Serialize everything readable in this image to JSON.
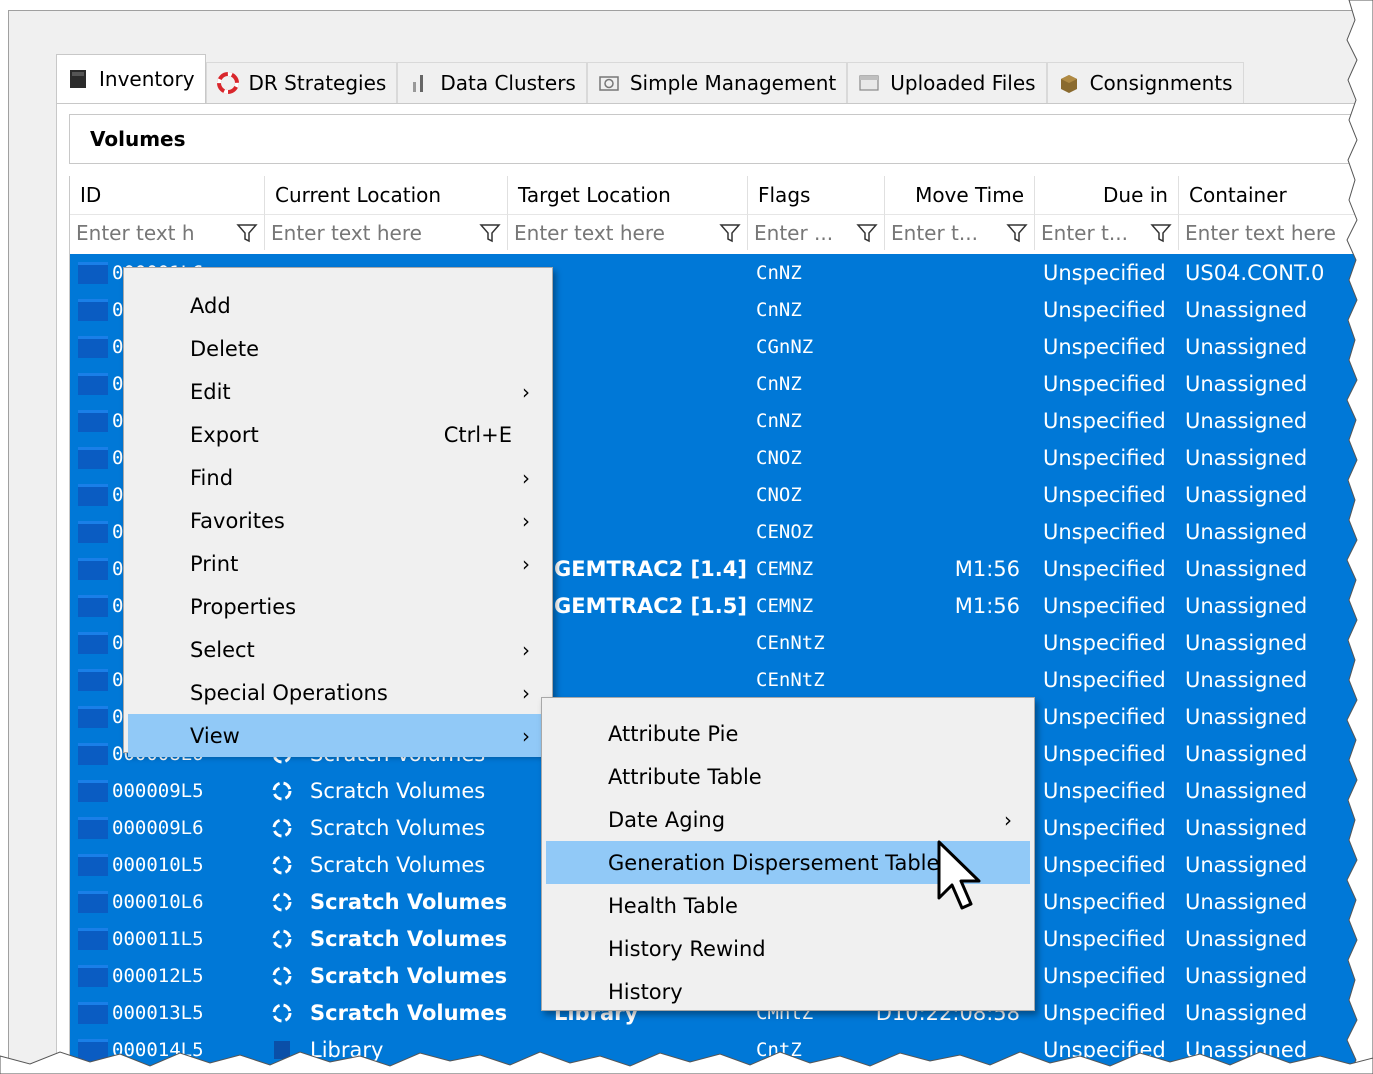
{
  "tabs": [
    {
      "label": "Inventory",
      "icon": "cartridge-icon",
      "active": true
    },
    {
      "label": "DR Strategies",
      "icon": "lifebuoy-icon",
      "active": false
    },
    {
      "label": "Data Clusters",
      "icon": "cluster-icon",
      "active": false
    },
    {
      "label": "Simple Management",
      "icon": "camera-icon",
      "active": false
    },
    {
      "label": "Uploaded Files",
      "icon": "folder-icon",
      "active": false
    },
    {
      "label": "Consignments",
      "icon": "box-icon",
      "active": false
    }
  ],
  "section_title": "Volumes",
  "columns": [
    "ID",
    "Current Location",
    "Target Location",
    "Flags",
    "Move Time",
    "Due in",
    "Container"
  ],
  "filter_placeholders": [
    "Enter text h",
    "Enter text here",
    "Enter text here",
    "Enter ...",
    "Enter t...",
    "Enter t...",
    "Enter text here"
  ],
  "rows": [
    {
      "id": "000001L6",
      "flags": "CnNZ",
      "due": "Unspecified",
      "container": "US04.CONT.0"
    },
    {
      "id": "0",
      "flags": "CnNZ",
      "due": "Unspecified",
      "container": "Unassigned"
    },
    {
      "id": "0",
      "flags": "CGnNZ",
      "due": "Unspecified",
      "container": "Unassigned"
    },
    {
      "id": "0",
      "flags": "CnNZ",
      "due": "Unspecified",
      "container": "Unassigned"
    },
    {
      "id": "0",
      "flags": "CnNZ",
      "due": "Unspecified",
      "container": "Unassigned"
    },
    {
      "id": "0",
      "flags": "CNOZ",
      "due": "Unspecified",
      "container": "Unassigned"
    },
    {
      "id": "0",
      "flags": "CNOZ",
      "due": "Unspecified",
      "container": "Unassigned"
    },
    {
      "id": "0",
      "flags": "CENOZ",
      "due": "Unspecified",
      "container": "Unassigned"
    },
    {
      "id": "0",
      "target": "GEMTRAC2 [1.4]",
      "flags": "CEMNZ",
      "move": "M1:56",
      "due": "Unspecified",
      "container": "Unassigned"
    },
    {
      "id": "0",
      "target": "GEMTRAC2 [1.5]",
      "flags": "CEMNZ",
      "move": "M1:56",
      "due": "Unspecified",
      "container": "Unassigned"
    },
    {
      "id": "0",
      "flags": "CEnNtZ",
      "due": "Unspecified",
      "container": "Unassigned"
    },
    {
      "id": "0",
      "flags": "CEnNtZ",
      "due": "Unspecified",
      "container": "Unassigned"
    },
    {
      "id": "0",
      "due": "Unspecified",
      "container": "Unassigned"
    },
    {
      "id": "000008L6",
      "location": "Scratch Volumes",
      "due": "Unspecified",
      "container": "Unassigned"
    },
    {
      "id": "000009L5",
      "location": "Scratch Volumes",
      "due": "Unspecified",
      "container": "Unassigned"
    },
    {
      "id": "000009L6",
      "location": "Scratch Volumes",
      "due": "Unspecified",
      "container": "Unassigned"
    },
    {
      "id": "000010L5",
      "location": "Scratch Volumes",
      "due": "Unspecified",
      "container": "Unassigned"
    },
    {
      "id": "000010L6",
      "location": "Scratch Volumes",
      "bold": true,
      "due": "Unspecified",
      "container": "Unassigned"
    },
    {
      "id": "000011L5",
      "location": "Scratch Volumes",
      "bold": true,
      "due": "Unspecified",
      "container": "Unassigned"
    },
    {
      "id": "000012L5",
      "location": "Scratch Volumes",
      "bold": true,
      "due": "Unspecified",
      "container": "Unassigned"
    },
    {
      "id": "000013L5",
      "location": "Scratch Volumes",
      "bold": true,
      "target": "Library",
      "flags": "CMntZ",
      "move": "D10:22:08:58",
      "due": "Unspecified",
      "container": "Unassigned"
    },
    {
      "id": "000014L5",
      "location": "Library",
      "flags": "CntZ",
      "due": "Unspecified",
      "container": "Unassigned"
    }
  ],
  "context_menu": [
    {
      "label": "Add"
    },
    {
      "label": "Delete"
    },
    {
      "label": "Edit",
      "submenu": true
    },
    {
      "label": "Export",
      "shortcut": "Ctrl+E"
    },
    {
      "label": "Find",
      "submenu": true
    },
    {
      "label": "Favorites",
      "submenu": true
    },
    {
      "label": "Print",
      "submenu": true
    },
    {
      "label": "Properties"
    },
    {
      "label": "Select",
      "submenu": true
    },
    {
      "label": "Special Operations",
      "submenu": true
    },
    {
      "label": "View",
      "submenu": true,
      "highlighted": true
    }
  ],
  "view_submenu": [
    {
      "label": "Attribute Pie"
    },
    {
      "label": "Attribute Table"
    },
    {
      "label": "Date Aging",
      "submenu": true
    },
    {
      "label": "Generation Dispersement Table",
      "highlighted": true
    },
    {
      "label": "Health Table"
    },
    {
      "label": "History Rewind"
    },
    {
      "label": "History"
    }
  ],
  "colors": {
    "selection": "#0078d7",
    "menu_highlight": "#91c9f7",
    "menu_bg": "#f0f0f0"
  }
}
